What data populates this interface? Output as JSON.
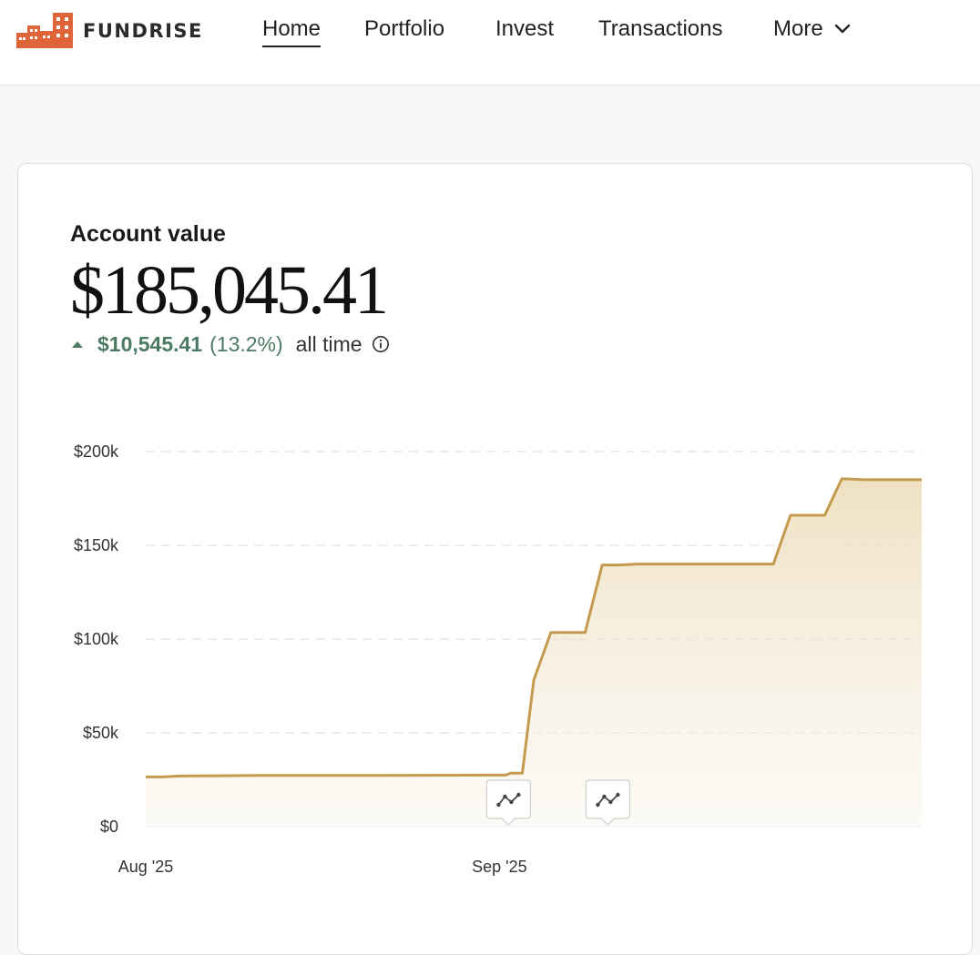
{
  "brand": {
    "name": "FUNDRISE",
    "color": "#e0643a"
  },
  "nav": {
    "items": [
      {
        "label": "Home",
        "active": true
      },
      {
        "label": "Portfolio",
        "active": false
      },
      {
        "label": "Invest",
        "active": false
      },
      {
        "label": "Transactions",
        "active": false
      }
    ],
    "more_label": "More",
    "more_icon": "chevron-down-icon"
  },
  "account": {
    "label": "Account value",
    "value": "$185,045.41",
    "change_amount": "$10,545.41",
    "change_percent": "(13.2%)",
    "period_label": "all time",
    "positive_color": "#4d7a63"
  },
  "chart_data": {
    "type": "area",
    "title": "",
    "xlabel": "",
    "ylabel": "",
    "ylim": [
      0,
      200000
    ],
    "y_ticks": [
      {
        "value": 0,
        "label": "$0"
      },
      {
        "value": 50000,
        "label": "$50k"
      },
      {
        "value": 100000,
        "label": "$100k"
      },
      {
        "value": 150000,
        "label": "$150k"
      },
      {
        "value": 200000,
        "label": "$200k"
      }
    ],
    "x_ticks": [
      {
        "label": "Aug '25",
        "day": 0
      },
      {
        "label": "Sep '25",
        "day": 31
      }
    ],
    "xlim_days": [
      0,
      68
    ],
    "series": [
      {
        "line_color": "#c49a4e",
        "points": [
          [
            0,
            26500
          ],
          [
            1.5,
            26500
          ],
          [
            3,
            27000
          ],
          [
            10,
            27300
          ],
          [
            20,
            27300
          ],
          [
            30,
            27500
          ],
          [
            31.5,
            27500
          ],
          [
            32,
            28500
          ],
          [
            33,
            28500
          ],
          [
            34,
            78000
          ],
          [
            35.5,
            103500
          ],
          [
            38.5,
            103500
          ],
          [
            40,
            139500
          ],
          [
            41.5,
            139500
          ],
          [
            43,
            140000
          ],
          [
            49,
            140000
          ],
          [
            55,
            140000
          ],
          [
            56.5,
            166000
          ],
          [
            59.5,
            166000
          ],
          [
            61,
            185500
          ],
          [
            63,
            185000
          ],
          [
            68,
            185000
          ]
        ]
      }
    ],
    "grid": true,
    "event_markers": [
      {
        "day": 31.8,
        "icon": "trend-line-icon"
      },
      {
        "day": 40.5,
        "icon": "trend-line-icon"
      }
    ]
  }
}
